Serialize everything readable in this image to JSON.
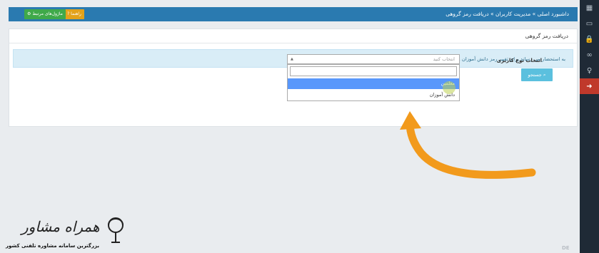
{
  "sidebar": {
    "items": [
      {
        "icon": "grid-icon",
        "glyph": "▦"
      },
      {
        "icon": "monitor-icon",
        "glyph": "▭"
      },
      {
        "icon": "lock-icon",
        "glyph": "🔒"
      },
      {
        "icon": "link-icon",
        "glyph": "∞"
      },
      {
        "icon": "lightbulb-icon",
        "glyph": "♀"
      },
      {
        "icon": "logout-icon",
        "glyph": "➜"
      }
    ],
    "active_color": "#c0392b"
  },
  "topbar": {
    "breadcrumb": "داشبورد اصلی » مدیریت کاربران » دریافت رمز گروهی",
    "help_button": "راهنما",
    "help_icon": "question-circle-icon",
    "modules_button": "ماژول‌های مرتبط",
    "modules_icon": "gears-icon"
  },
  "panel": {
    "title": "دریافت رمز گروهی",
    "alert": "به استحضار می رساند برای تغییر رمز دانش آموزان و معلمان به صورت انفرادی به ماژول مدیریت کاربران بخش ویرایش مراجعه کنید.",
    "field_label": "انتخاب نوع کاربری",
    "select": {
      "placeholder": "انتخاب کنید",
      "search_value": "",
      "options": [
        "معلمین",
        "دانش آموزان"
      ],
      "highlighted_index": 0
    },
    "search_button": "جستجو",
    "search_icon": "search-icon"
  },
  "watermark": {
    "title": "همراه مشاور",
    "subtitle": "بزرگترین سامانه مشاوره تلفنی کشور"
  },
  "footer_mark": "DE",
  "colors": {
    "topbar": "#2a7ab0",
    "sidebar": "#1f2a36",
    "alert_bg": "#d9edf7",
    "highlight": "#5897fb",
    "search_button": "#5bc0de",
    "annotation_arrow": "#f29a1c"
  }
}
